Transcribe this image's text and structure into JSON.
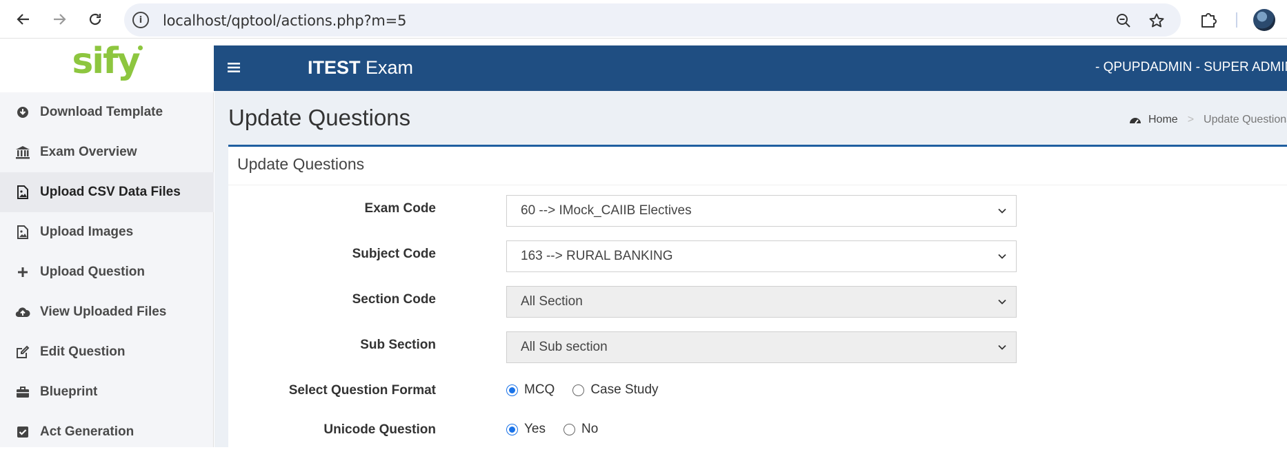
{
  "browser": {
    "url": "localhost/qptool/actions.php?m=5"
  },
  "sidebar": {
    "logo": "sify",
    "items": [
      {
        "label": "Download Template",
        "icon": "download-circle-icon"
      },
      {
        "label": "Exam Overview",
        "icon": "bank-icon"
      },
      {
        "label": "Upload CSV Data Files",
        "icon": "image-file-icon",
        "active": true
      },
      {
        "label": "Upload Images",
        "icon": "image-file-icon"
      },
      {
        "label": "Upload Question",
        "icon": "plus-icon"
      },
      {
        "label": "View Uploaded Files",
        "icon": "cloud-upload-icon"
      },
      {
        "label": "Edit Question",
        "icon": "edit-icon"
      },
      {
        "label": "Blueprint",
        "icon": "briefcase-icon"
      },
      {
        "label": "Act Generation",
        "icon": "check-square-icon"
      }
    ]
  },
  "header": {
    "brand_bold": "ITEST",
    "brand_rest": " Exam",
    "user": "- QPUPDADMIN - SUPER ADMIN"
  },
  "page": {
    "title": "Update Questions",
    "breadcrumb": {
      "home": "Home",
      "current": "Update Questions"
    }
  },
  "form": {
    "panel_title": "Update Questions",
    "exam_code": {
      "label": "Exam Code",
      "value": "60 --> IMock_CAIIB Electives"
    },
    "subject_code": {
      "label": "Subject Code",
      "value": "163 --> RURAL BANKING"
    },
    "section_code": {
      "label": "Section Code",
      "value": "All Section"
    },
    "sub_section": {
      "label": "Sub Section",
      "value": "All Sub section"
    },
    "question_format": {
      "label": "Select Question Format",
      "options": [
        "MCQ",
        "Case Study"
      ],
      "selected": "MCQ"
    },
    "unicode": {
      "label": "Unicode Question",
      "options": [
        "Yes",
        "No"
      ],
      "selected": "Yes"
    }
  },
  "colors": {
    "header_bg": "#1f4e82",
    "logo_green": "#8dc63f",
    "panel_accent": "#1f5fa0",
    "radio_blue": "#1a73e8"
  }
}
